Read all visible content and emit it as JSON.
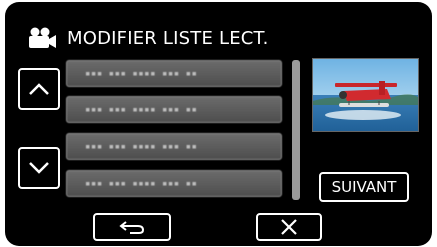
{
  "header": {
    "title": "MODIFIER LISTE LECT.",
    "mode_icon": "video-camera-icon"
  },
  "list": {
    "items": [
      {
        "label": "▪▪▪ ▪▪▪ ▪▪▪▪ ▪▪▪ ▪▪"
      },
      {
        "label": "▪▪▪ ▪▪▪ ▪▪▪▪ ▪▪▪ ▪▪"
      },
      {
        "label": "▪▪▪ ▪▪▪ ▪▪▪▪ ▪▪▪ ▪▪"
      },
      {
        "label": "▪▪▪ ▪▪▪ ▪▪▪▪ ▪▪▪ ▪▪"
      }
    ],
    "up_icon": "chevron-up-icon",
    "down_icon": "chevron-down-icon"
  },
  "preview": {
    "thumbnail_icon": "seaplane-thumbnail"
  },
  "buttons": {
    "next_label": "SUIVANT",
    "back_icon": "return-arrow-icon",
    "close_icon": "close-icon"
  },
  "colors": {
    "background": "#000000",
    "button_border": "#ffffff",
    "list_item": "#5c5c5c"
  }
}
